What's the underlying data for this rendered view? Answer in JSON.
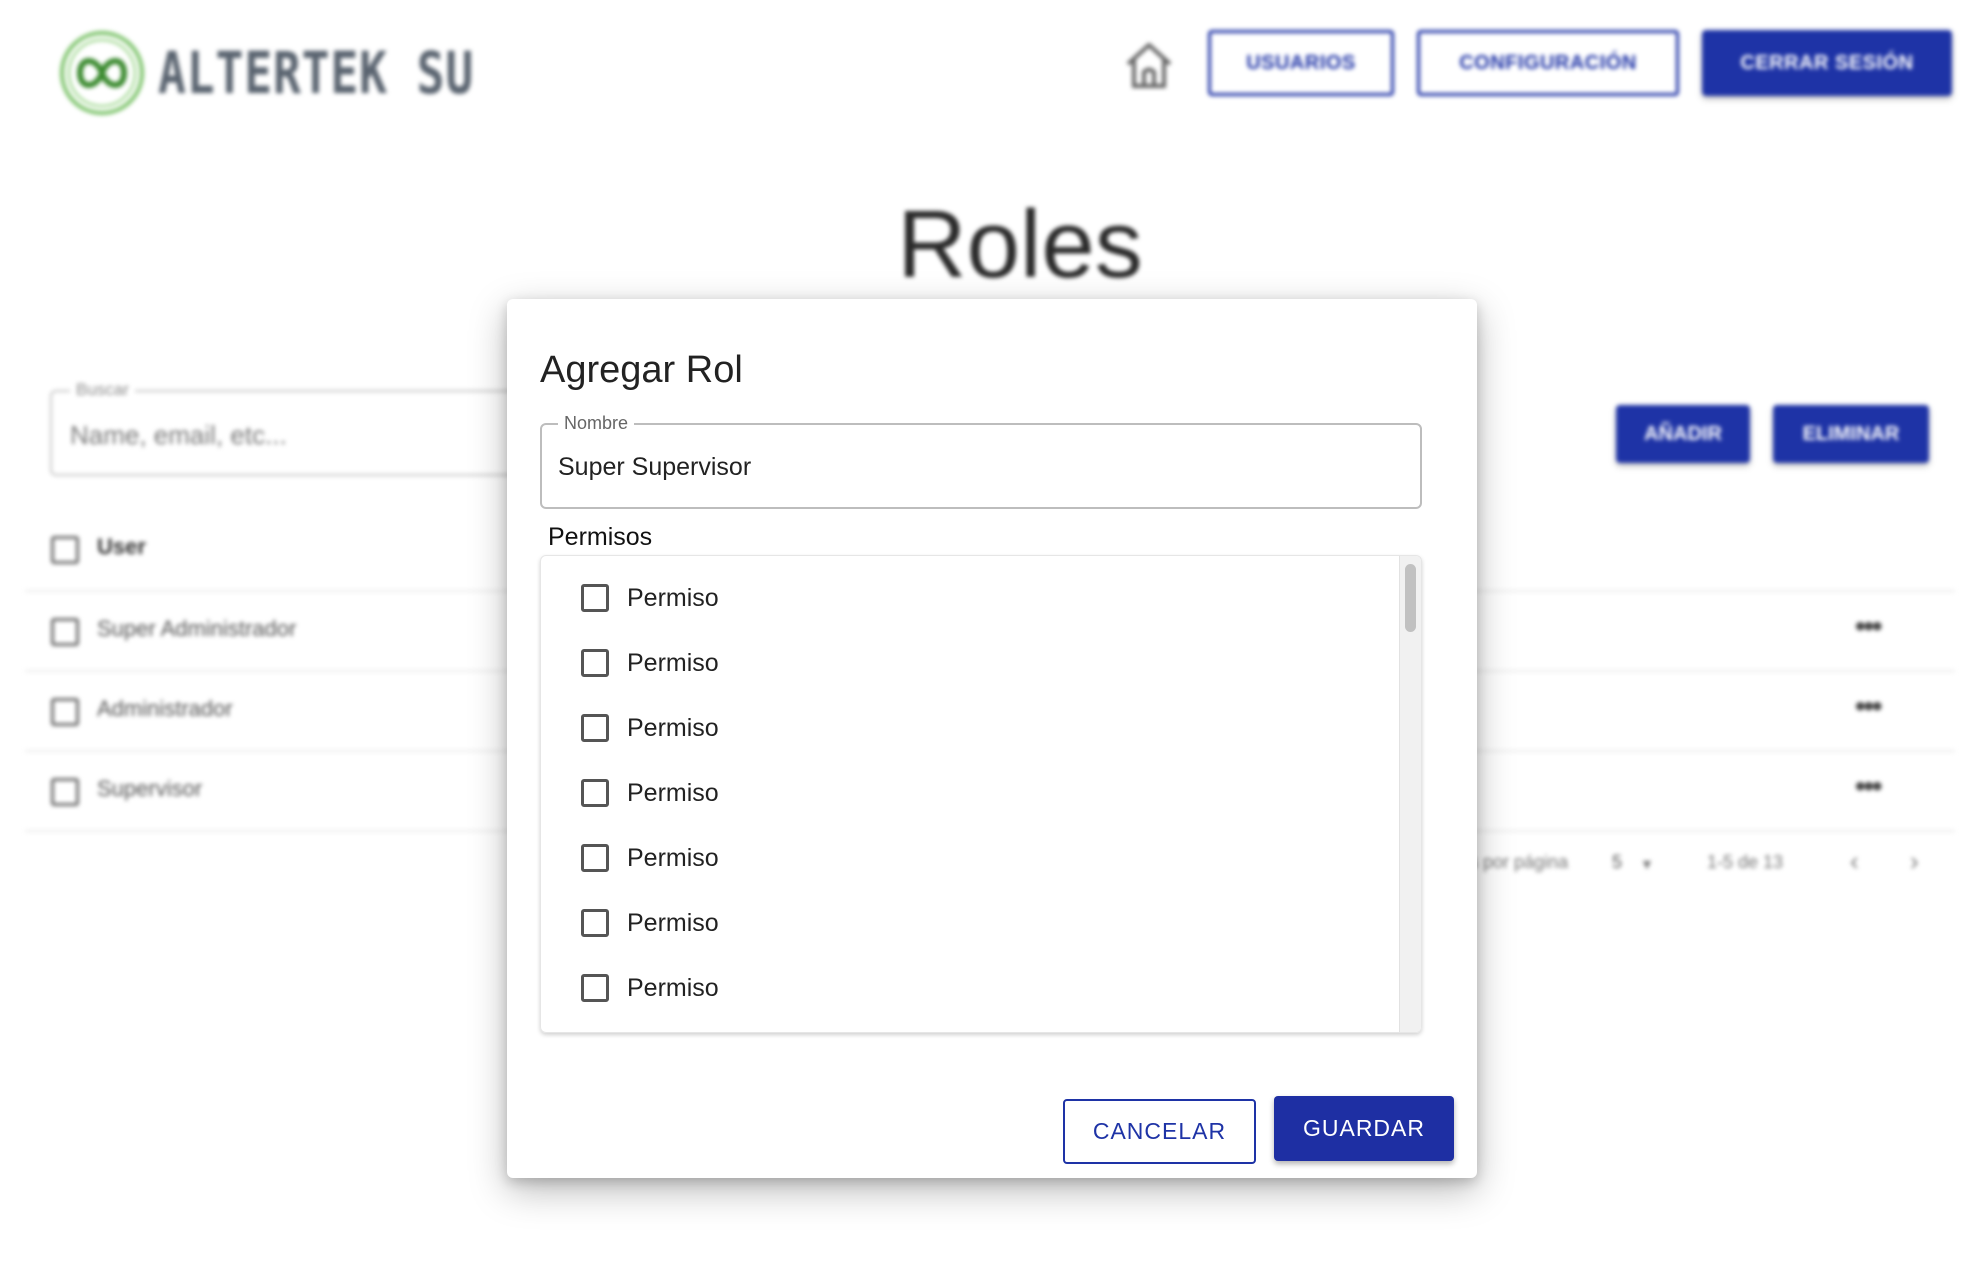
{
  "header": {
    "logo_text": "ALTERTEK SU",
    "nav": {
      "users_label": "USUARIOS",
      "config_label": "CONFIGURACIÓN",
      "logout_label": "CERRAR SESIÓN"
    }
  },
  "page": {
    "title": "Roles",
    "search": {
      "legend": "Buscar",
      "placeholder": "Name, email, etc..."
    },
    "add_label": "AÑADIR",
    "delete_label": "ELIMINAR",
    "table": {
      "header": "User",
      "rows": [
        "Super Administrador",
        "Administrador",
        "Supervisor"
      ],
      "more_glyph": "•••"
    },
    "pagination": {
      "rows_per_page_label": "Filas por página",
      "rows_per_page_value": "5",
      "range": "1-5 de 13"
    }
  },
  "dialog": {
    "title": "Agregar Rol",
    "name_field": {
      "legend": "Nombre",
      "value": "Super Supervisor"
    },
    "permissions_label": "Permisos",
    "permissions": [
      "Permiso",
      "Permiso",
      "Permiso",
      "Permiso",
      "Permiso",
      "Permiso",
      "Permiso"
    ],
    "cancel_label": "CANCELAR",
    "save_label": "GUARDAR"
  },
  "colors": {
    "primary": "#1e33a6",
    "logo_green": "#6ab04c",
    "logo_gray": "#5a6470"
  }
}
